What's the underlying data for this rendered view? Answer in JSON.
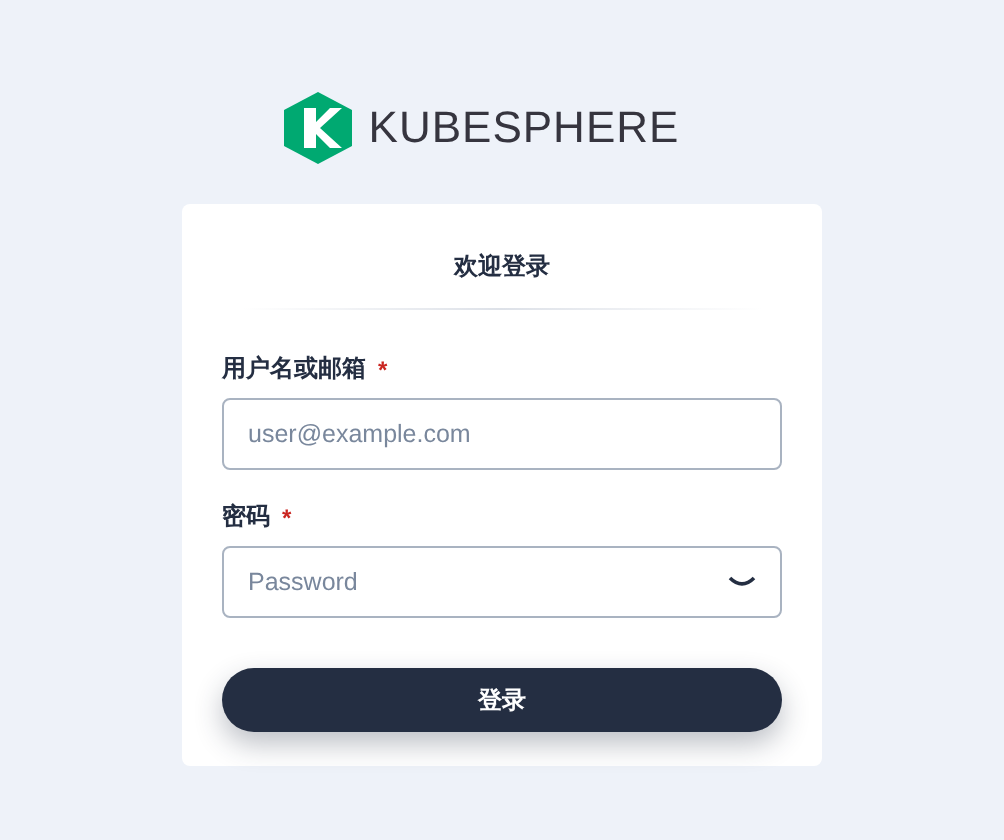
{
  "logo": {
    "wordmark": "KUBESPHERE"
  },
  "login": {
    "title": "欢迎登录",
    "fields": [
      {
        "kind": "text",
        "label": "用户名或邮箱",
        "required_mark": "*",
        "placeholder": "user@example.com"
      },
      {
        "kind": "password",
        "label": "密码",
        "required_mark": "*",
        "placeholder": "Password"
      }
    ],
    "submit": "登录"
  }
}
